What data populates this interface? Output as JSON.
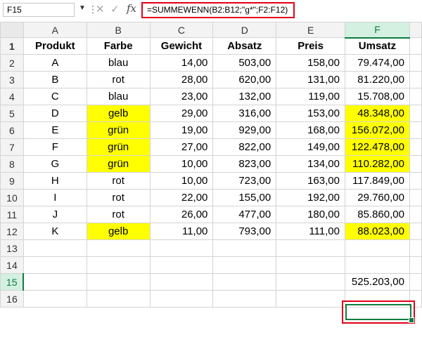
{
  "formula_bar": {
    "name_box": "F15",
    "formula": "=SUMMEWENN(B2:B12;\"g*\";F2:F12)",
    "icons": [
      "chevron-down-icon",
      "more-options-icon",
      "cancel-icon",
      "confirm-icon",
      "function-icon"
    ]
  },
  "columns": [
    "A",
    "B",
    "C",
    "D",
    "E",
    "F"
  ],
  "row_numbers": [
    "1",
    "2",
    "3",
    "4",
    "5",
    "6",
    "7",
    "8",
    "9",
    "10",
    "11",
    "12",
    "13",
    "14",
    "15",
    "16"
  ],
  "headers": [
    "Produkt",
    "Farbe",
    "Gewicht",
    "Absatz",
    "Preis",
    "Umsatz"
  ],
  "rows": [
    [
      "A",
      "blau",
      "14,00",
      "503,00",
      "158,00",
      "79.474,00"
    ],
    [
      "B",
      "rot",
      "28,00",
      "620,00",
      "131,00",
      "81.220,00"
    ],
    [
      "C",
      "blau",
      "23,00",
      "132,00",
      "119,00",
      "15.708,00"
    ],
    [
      "D",
      "gelb",
      "29,00",
      "316,00",
      "153,00",
      "48.348,00"
    ],
    [
      "E",
      "grün",
      "19,00",
      "929,00",
      "168,00",
      "156.072,00"
    ],
    [
      "F",
      "grün",
      "27,00",
      "822,00",
      "149,00",
      "122.478,00"
    ],
    [
      "G",
      "grün",
      "10,00",
      "823,00",
      "134,00",
      "110.282,00"
    ],
    [
      "H",
      "rot",
      "10,00",
      "723,00",
      "163,00",
      "117.849,00"
    ],
    [
      "I",
      "rot",
      "22,00",
      "155,00",
      "192,00",
      "29.760,00"
    ],
    [
      "J",
      "rot",
      "26,00",
      "477,00",
      "180,00",
      "85.860,00"
    ],
    [
      "K",
      "gelb",
      "11,00",
      "793,00",
      "111,00",
      "88.023,00"
    ]
  ],
  "highlighted_rows": [
    3,
    4,
    5,
    6,
    10
  ],
  "result": {
    "cell": "F15",
    "value": "525.203,00"
  },
  "colors": {
    "highlight": "#ffff00",
    "selection": "#107c41",
    "callout": "#e2001a"
  }
}
